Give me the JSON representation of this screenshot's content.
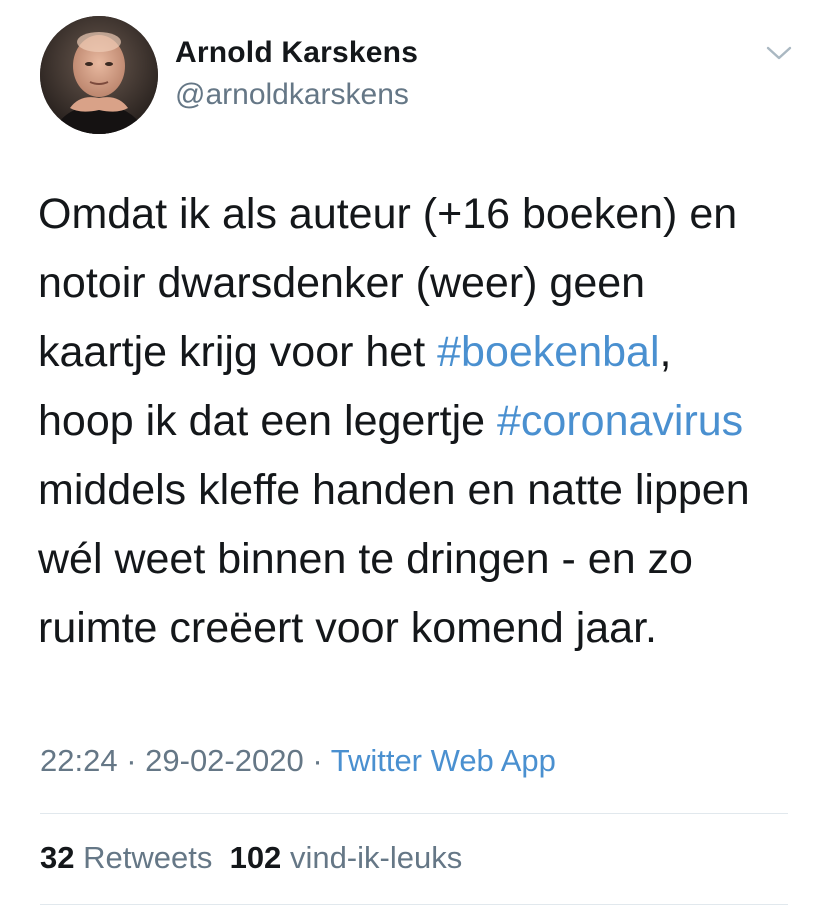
{
  "author": {
    "name": "Arnold Karskens",
    "handle": "@arnoldkarskens"
  },
  "tweet": {
    "lines": [
      [
        {
          "text": "Omdat ik als auteur (+16 boeken) en"
        }
      ],
      [
        {
          "text": "notoir dwarsdenker (weer) geen"
        }
      ],
      [
        {
          "text": "kaartje krijg voor het "
        },
        {
          "text": "#boekenbal",
          "hashtag": true
        },
        {
          "text": ","
        }
      ],
      [
        {
          "text": "hoop ik dat een legertje "
        },
        {
          "text": "#coronavirus",
          "hashtag": true
        }
      ],
      [
        {
          "text": "middels kleffe handen en natte lippen"
        }
      ],
      [
        {
          "text": "wél weet binnen te dringen - en zo"
        }
      ],
      [
        {
          "text": "ruimte creëert voor komend jaar."
        }
      ]
    ]
  },
  "meta": {
    "time": "22:24",
    "separator": " · ",
    "date": "29-02-2020",
    "source": "Twitter Web App"
  },
  "stats": {
    "retweets_count": "32",
    "retweets_label": "Retweets",
    "likes_count": "102",
    "likes_label": "vind-ik-leuks"
  },
  "colors": {
    "text": "#14171a",
    "secondary": "#657786",
    "link": "#4a90d0",
    "divider": "#e1e8ed"
  },
  "icons": {
    "menu": "chevron-down-icon"
  }
}
